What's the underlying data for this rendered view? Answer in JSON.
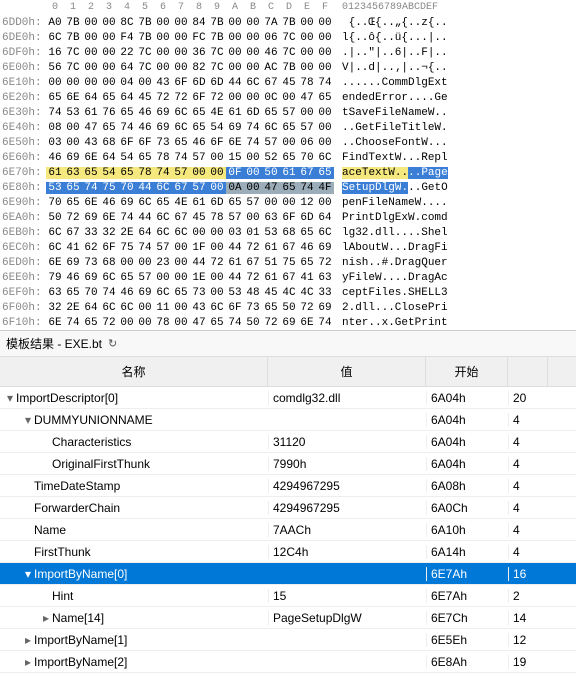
{
  "hex_header": {
    "offset": "",
    "cols": [
      "0",
      "1",
      "2",
      "3",
      "4",
      "5",
      "6",
      "7",
      "8",
      "9",
      "A",
      "B",
      "C",
      "D",
      "E",
      "F"
    ],
    "ascii": "0123456789ABCDEF"
  },
  "hex_rows": [
    {
      "offset": "6DD0h:",
      "bytes": [
        "A0",
        "7B",
        "00",
        "00",
        "8C",
        "7B",
        "00",
        "00",
        "84",
        "7B",
        "00",
        "00",
        "7A",
        "7B",
        "00",
        "00"
      ],
      "ascii": " {..Œ{..„{..z{.."
    },
    {
      "offset": "6DE0h:",
      "bytes": [
        "6C",
        "7B",
        "00",
        "00",
        "F4",
        "7B",
        "00",
        "00",
        "FC",
        "7B",
        "00",
        "00",
        "06",
        "7C",
        "00",
        "00"
      ],
      "ascii": "l{..ô{..ü{...|.."
    },
    {
      "offset": "6DF0h:",
      "bytes": [
        "16",
        "7C",
        "00",
        "00",
        "22",
        "7C",
        "00",
        "00",
        "36",
        "7C",
        "00",
        "00",
        "46",
        "7C",
        "00",
        "00"
      ],
      "ascii": ".|..\"|..6|..F|.."
    },
    {
      "offset": "6E00h:",
      "bytes": [
        "56",
        "7C",
        "00",
        "00",
        "64",
        "7C",
        "00",
        "00",
        "82",
        "7C",
        "00",
        "00",
        "AC",
        "7B",
        "00",
        "00"
      ],
      "ascii": "V|..d|..‚|..¬{.."
    },
    {
      "offset": "6E10h:",
      "bytes": [
        "00",
        "00",
        "00",
        "00",
        "04",
        "00",
        "43",
        "6F",
        "6D",
        "6D",
        "44",
        "6C",
        "67",
        "45",
        "78",
        "74"
      ],
      "ascii": "......CommDlgExt"
    },
    {
      "offset": "6E20h:",
      "bytes": [
        "65",
        "6E",
        "64",
        "65",
        "64",
        "45",
        "72",
        "72",
        "6F",
        "72",
        "00",
        "00",
        "0C",
        "00",
        "47",
        "65"
      ],
      "ascii": "endedError....Ge"
    },
    {
      "offset": "6E30h:",
      "bytes": [
        "74",
        "53",
        "61",
        "76",
        "65",
        "46",
        "69",
        "6C",
        "65",
        "4E",
        "61",
        "6D",
        "65",
        "57",
        "00",
        "00"
      ],
      "ascii": "tSaveFileNameW.."
    },
    {
      "offset": "6E40h:",
      "bytes": [
        "08",
        "00",
        "47",
        "65",
        "74",
        "46",
        "69",
        "6C",
        "65",
        "54",
        "69",
        "74",
        "6C",
        "65",
        "57",
        "00"
      ],
      "ascii": "..GetFileTitleW."
    },
    {
      "offset": "6E50h:",
      "bytes": [
        "03",
        "00",
        "43",
        "68",
        "6F",
        "6F",
        "73",
        "65",
        "46",
        "6F",
        "6E",
        "74",
        "57",
        "00",
        "06",
        "00"
      ],
      "ascii": "..ChooseFontW..."
    },
    {
      "offset": "6E60h:",
      "bytes": [
        "46",
        "69",
        "6E",
        "64",
        "54",
        "65",
        "78",
        "74",
        "57",
        "00",
        "15",
        "00",
        "52",
        "65",
        "70",
        "6C"
      ],
      "ascii": "FindTextW...Repl"
    },
    {
      "offset": "6E70h:",
      "bytes": [
        "61",
        "63",
        "65",
        "54",
        "65",
        "78",
        "74",
        "57",
        "00",
        "00",
        "0F",
        "00",
        "50",
        "61",
        "67",
        "65"
      ],
      "ascii": "aceTextW....Page",
      "row_hl": "yellow",
      "byte_hl": {
        "10": "hb",
        "11": "hb",
        "12": "hb",
        "13": "hb",
        "14": "hb",
        "15": "hb"
      },
      "ascii_hl": {
        "0": "ay",
        "1": "ay",
        "2": "ay",
        "3": "ay",
        "4": "ay",
        "5": "ay",
        "6": "ay",
        "7": "ay",
        "8": "ay",
        "9": "ay",
        "10": "ab",
        "11": "ab",
        "12": "ab",
        "13": "ab",
        "14": "ab",
        "15": "ab"
      }
    },
    {
      "offset": "6E80h:",
      "bytes": [
        "53",
        "65",
        "74",
        "75",
        "70",
        "44",
        "6C",
        "67",
        "57",
        "00",
        "0A",
        "00",
        "47",
        "65",
        "74",
        "4F"
      ],
      "ascii": "SetupDlgW...GetO",
      "byte_hl": {
        "0": "hb",
        "1": "hb",
        "2": "hb",
        "3": "hb",
        "4": "hb",
        "5": "hb",
        "6": "hb",
        "7": "hb",
        "8": "hb",
        "9": "hb",
        "10": "hg",
        "11": "hg",
        "12": "hg",
        "13": "hg",
        "14": "hg",
        "15": "hg"
      },
      "ascii_hl": {
        "0": "ab",
        "1": "ab",
        "2": "ab",
        "3": "ab",
        "4": "ab",
        "5": "ab",
        "6": "ab",
        "7": "ab",
        "8": "ab",
        "9": "ab"
      }
    },
    {
      "offset": "6E90h:",
      "bytes": [
        "70",
        "65",
        "6E",
        "46",
        "69",
        "6C",
        "65",
        "4E",
        "61",
        "6D",
        "65",
        "57",
        "00",
        "00",
        "12",
        "00"
      ],
      "ascii": "penFileNameW...."
    },
    {
      "offset": "6EA0h:",
      "bytes": [
        "50",
        "72",
        "69",
        "6E",
        "74",
        "44",
        "6C",
        "67",
        "45",
        "78",
        "57",
        "00",
        "63",
        "6F",
        "6D",
        "64"
      ],
      "ascii": "PrintDlgExW.comd"
    },
    {
      "offset": "6EB0h:",
      "bytes": [
        "6C",
        "67",
        "33",
        "32",
        "2E",
        "64",
        "6C",
        "6C",
        "00",
        "00",
        "03",
        "01",
        "53",
        "68",
        "65",
        "6C"
      ],
      "ascii": "lg32.dll....Shel"
    },
    {
      "offset": "6EC0h:",
      "bytes": [
        "6C",
        "41",
        "62",
        "6F",
        "75",
        "74",
        "57",
        "00",
        "1F",
        "00",
        "44",
        "72",
        "61",
        "67",
        "46",
        "69"
      ],
      "ascii": "lAboutW...DragFi"
    },
    {
      "offset": "6ED0h:",
      "bytes": [
        "6E",
        "69",
        "73",
        "68",
        "00",
        "00",
        "23",
        "00",
        "44",
        "72",
        "61",
        "67",
        "51",
        "75",
        "65",
        "72"
      ],
      "ascii": "nish..#.DragQuer"
    },
    {
      "offset": "6EE0h:",
      "bytes": [
        "79",
        "46",
        "69",
        "6C",
        "65",
        "57",
        "00",
        "00",
        "1E",
        "00",
        "44",
        "72",
        "61",
        "67",
        "41",
        "63"
      ],
      "ascii": "yFileW....DragAc"
    },
    {
      "offset": "6EF0h:",
      "bytes": [
        "63",
        "65",
        "70",
        "74",
        "46",
        "69",
        "6C",
        "65",
        "73",
        "00",
        "53",
        "48",
        "45",
        "4C",
        "4C",
        "33"
      ],
      "ascii": "ceptFiles.SHELL3"
    },
    {
      "offset": "6F00h:",
      "bytes": [
        "32",
        "2E",
        "64",
        "6C",
        "6C",
        "00",
        "11",
        "00",
        "43",
        "6C",
        "6F",
        "73",
        "65",
        "50",
        "72",
        "69"
      ],
      "ascii": "2.dll...ClosePri"
    },
    {
      "offset": "6F10h:",
      "bytes": [
        "6E",
        "74",
        "65",
        "72",
        "00",
        "00",
        "78",
        "00",
        "47",
        "65",
        "74",
        "50",
        "72",
        "69",
        "6E",
        "74"
      ],
      "ascii": "nter..x.GetPrint"
    }
  ],
  "tab": {
    "label": "模板结果 - EXE.bt",
    "refresh_icon": "↻"
  },
  "tree_header": {
    "name": "名称",
    "value": "值",
    "start": "开始",
    "size": ""
  },
  "tree_rows": [
    {
      "indent": 0,
      "expander": "▾",
      "name": "ImportDescriptor[0]",
      "value": "comdlg32.dll",
      "start": "6A04h",
      "size": "20"
    },
    {
      "indent": 1,
      "expander": "▾",
      "name": "DUMMYUNIONNAME",
      "value": "",
      "start": "6A04h",
      "size": "4"
    },
    {
      "indent": 2,
      "expander": "",
      "name": "Characteristics",
      "value": "31120",
      "start": "6A04h",
      "size": "4"
    },
    {
      "indent": 2,
      "expander": "",
      "name": "OriginalFirstThunk",
      "value": "7990h",
      "start": "6A04h",
      "size": "4"
    },
    {
      "indent": 1,
      "expander": "",
      "name": "TimeDateStamp",
      "value": "4294967295",
      "start": "6A08h",
      "size": "4"
    },
    {
      "indent": 1,
      "expander": "",
      "name": "ForwarderChain",
      "value": "4294967295",
      "start": "6A0Ch",
      "size": "4"
    },
    {
      "indent": 1,
      "expander": "",
      "name": "Name",
      "value": "7AACh",
      "start": "6A10h",
      "size": "4"
    },
    {
      "indent": 1,
      "expander": "",
      "name": "FirstThunk",
      "value": "12C4h",
      "start": "6A14h",
      "size": "4"
    },
    {
      "indent": 1,
      "expander": "▾",
      "name": "ImportByName[0]",
      "value": "",
      "start": "6E7Ah",
      "size": "16",
      "selected": true
    },
    {
      "indent": 2,
      "expander": "",
      "name": "Hint",
      "value": "15",
      "start": "6E7Ah",
      "size": "2"
    },
    {
      "indent": 2,
      "expander": "▸",
      "name": "Name[14]",
      "value": "PageSetupDlgW",
      "start": "6E7Ch",
      "size": "14"
    },
    {
      "indent": 1,
      "expander": "▸",
      "name": "ImportByName[1]",
      "value": "",
      "start": "6E5Eh",
      "size": "12"
    },
    {
      "indent": 1,
      "expander": "▸",
      "name": "ImportByName[2]",
      "value": "",
      "start": "6E8Ah",
      "size": "19"
    }
  ]
}
